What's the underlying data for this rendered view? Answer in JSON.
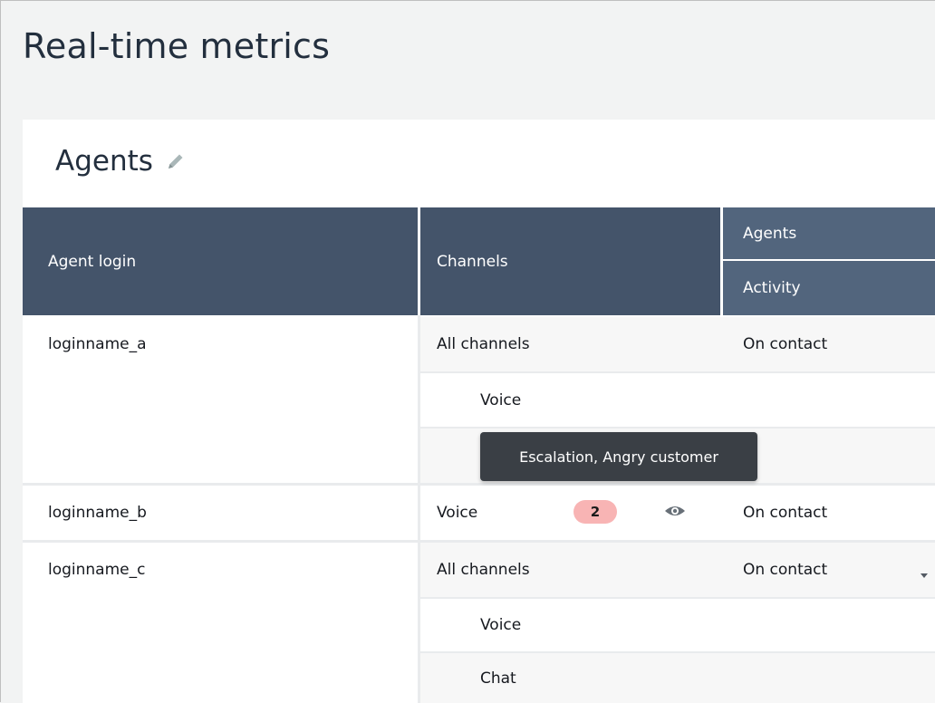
{
  "page": {
    "title": "Real-time metrics"
  },
  "panel": {
    "title": "Agents",
    "edit_icon": "pencil-icon"
  },
  "table": {
    "headers": {
      "agent_login": "Agent login",
      "channels": "Channels",
      "group": "Agents",
      "activity": "Activity"
    },
    "rows": [
      {
        "login": "loginname_a",
        "channel_rows": [
          {
            "channel": "All channels",
            "activity": "On contact"
          },
          {
            "channel": "Voice",
            "activity": ""
          },
          {
            "channel": "",
            "activity": ""
          }
        ]
      },
      {
        "login": "loginname_b",
        "channel_rows": [
          {
            "channel": "Voice",
            "activity": "On contact",
            "badge": "2",
            "view_icon": "eye-icon"
          }
        ]
      },
      {
        "login": "loginname_c",
        "channel_rows": [
          {
            "channel": "All channels",
            "activity": "On contact",
            "dropdown_icon": "caret-down-icon"
          },
          {
            "channel": "Voice",
            "activity": ""
          },
          {
            "channel": "Chat",
            "activity": ""
          }
        ]
      }
    ]
  },
  "tooltip": {
    "text": "Escalation, Angry customer"
  },
  "colors": {
    "header_bg": "#44546a",
    "subheader_bg": "#52657d",
    "badge_bg": "#f8b4b4",
    "tooltip_bg": "#3a3f45",
    "page_bg": "#f2f3f3"
  }
}
